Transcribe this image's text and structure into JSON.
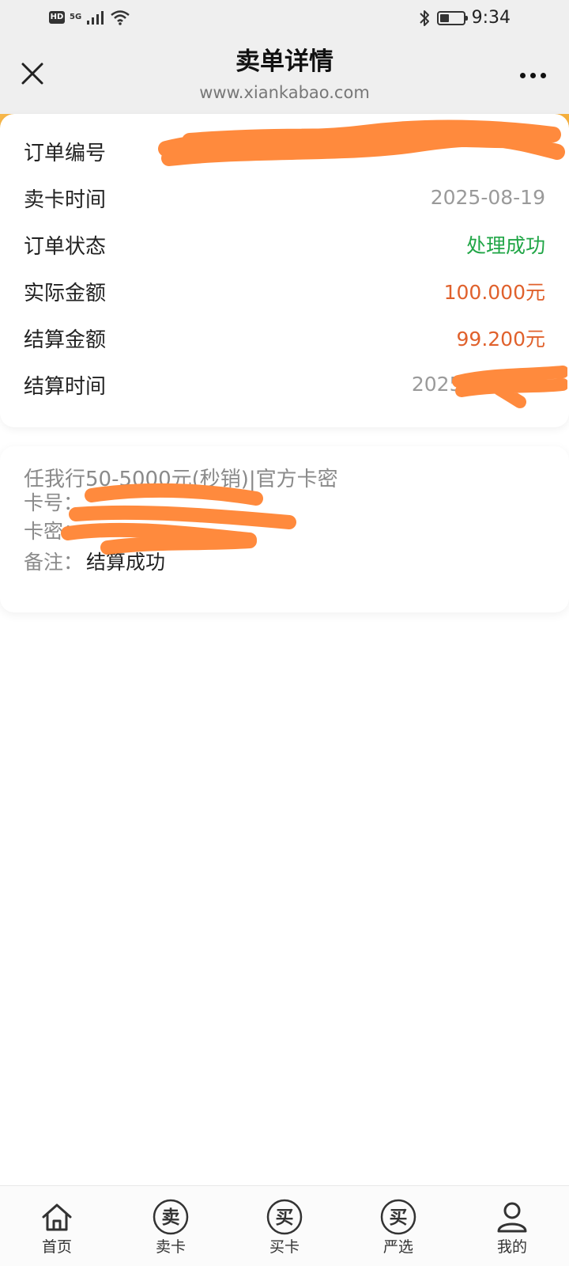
{
  "status_bar": {
    "hd": "HD",
    "network": "5G",
    "time": "9:34"
  },
  "header": {
    "title": "卖单详情",
    "url": "www.xiankabao.com",
    "close_icon": "close-icon",
    "more_icon": "more-horizontal-icon"
  },
  "order": {
    "rows": [
      {
        "label": "订单编号",
        "value": ""
      },
      {
        "label": "卖卡时间",
        "value": "2025-08-19"
      },
      {
        "label": "订单状态",
        "value": "处理成功"
      },
      {
        "label": "实际金额",
        "value": "100.000元"
      },
      {
        "label": "结算金额",
        "value": "99.200元"
      },
      {
        "label": "结算时间",
        "value": "2025-08-19 1"
      }
    ]
  },
  "card": {
    "product": "任我行50-5000元(秒销)|官方卡密",
    "number_label": "卡号：",
    "number_value": "",
    "pin_label": "卡密：",
    "pin_value": "",
    "note_label": "备注：",
    "note_value": "结算成功"
  },
  "nav": [
    {
      "label": "首页",
      "icon": "home-icon"
    },
    {
      "label": "卖卡",
      "icon": "sell-icon",
      "glyph": "卖"
    },
    {
      "label": "买卡",
      "icon": "buy-icon",
      "glyph": "买"
    },
    {
      "label": "严选",
      "icon": "select-icon",
      "glyph": "买"
    },
    {
      "label": "我的",
      "icon": "user-icon"
    }
  ],
  "colors": {
    "status_green": "#21a647",
    "amount_orange": "#e0612c",
    "accent": "#f7b74a",
    "redaction": "#ff8a3d"
  }
}
